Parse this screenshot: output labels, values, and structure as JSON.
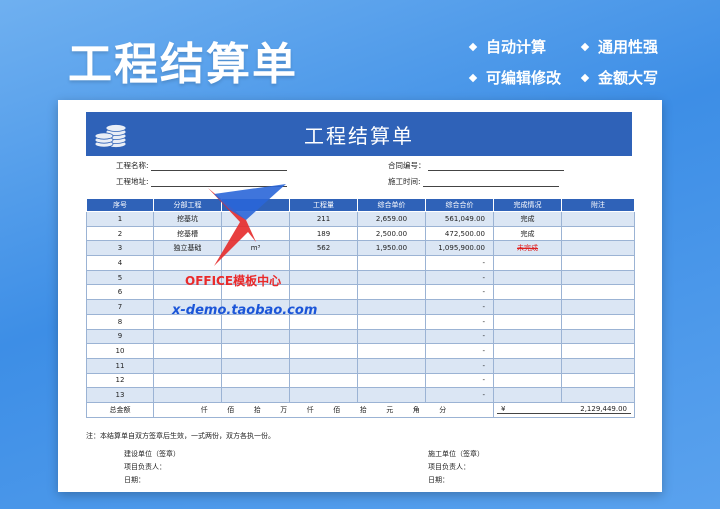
{
  "banner": {
    "title": "工程结算单",
    "features": [
      "自动计算",
      "通用性强",
      "可编辑修改",
      "金额大写"
    ]
  },
  "sheet": {
    "title": "工程结算单",
    "project_name_label": "工程名称:",
    "project_address_label": "工程地址:",
    "contract_no_label": "合同编号：",
    "construction_time_label": "施工时间:"
  },
  "table": {
    "headers": [
      "序号",
      "分部工程",
      "",
      "工程量",
      "综合单价",
      "综合合价",
      "完成情况",
      "附注"
    ],
    "rows": [
      [
        "1",
        "挖基坑",
        "",
        "211",
        "2,659.00",
        "561,049.00",
        "完成",
        ""
      ],
      [
        "2",
        "挖基槽",
        "",
        "189",
        "2,500.00",
        "472,500.00",
        "完成",
        ""
      ],
      [
        "3",
        "独立基础",
        "m³",
        "562",
        "1,950.00",
        "1,095,900.00",
        "未完成",
        ""
      ],
      [
        "4",
        "",
        "",
        "",
        "",
        "-",
        "",
        ""
      ],
      [
        "5",
        "",
        "",
        "",
        "",
        "-",
        "",
        ""
      ],
      [
        "6",
        "",
        "",
        "",
        "",
        "-",
        "",
        ""
      ],
      [
        "7",
        "",
        "",
        "",
        "",
        "-",
        "",
        ""
      ],
      [
        "8",
        "",
        "",
        "",
        "",
        "-",
        "",
        ""
      ],
      [
        "9",
        "",
        "",
        "",
        "",
        "-",
        "",
        ""
      ],
      [
        "10",
        "",
        "",
        "",
        "",
        "-",
        "",
        ""
      ],
      [
        "11",
        "",
        "",
        "",
        "",
        "-",
        "",
        ""
      ],
      [
        "12",
        "",
        "",
        "",
        "",
        "-",
        "",
        ""
      ],
      [
        "13",
        "",
        "",
        "",
        "",
        "-",
        "",
        ""
      ]
    ],
    "total_label": "总金额",
    "upper_units": [
      "仟",
      "佰",
      "拾",
      "万",
      "仟",
      "佰",
      "拾",
      "元",
      "角",
      "分"
    ],
    "currency_symbol": "¥",
    "total_value": "2,129,449.00"
  },
  "footer": {
    "note": "注：本结算单自双方签章后生效，一式两份，双方各执一份。",
    "left_unit": "建设单位（签章）",
    "left_manager": "项目负责人：",
    "left_date": "日期：",
    "right_unit": "施工单位（签章）",
    "right_manager": "项目负责人：",
    "right_date": "日期："
  },
  "watermark": {
    "line1": "OFFICE模板中心",
    "line2": "x-demo.taobao.com"
  }
}
